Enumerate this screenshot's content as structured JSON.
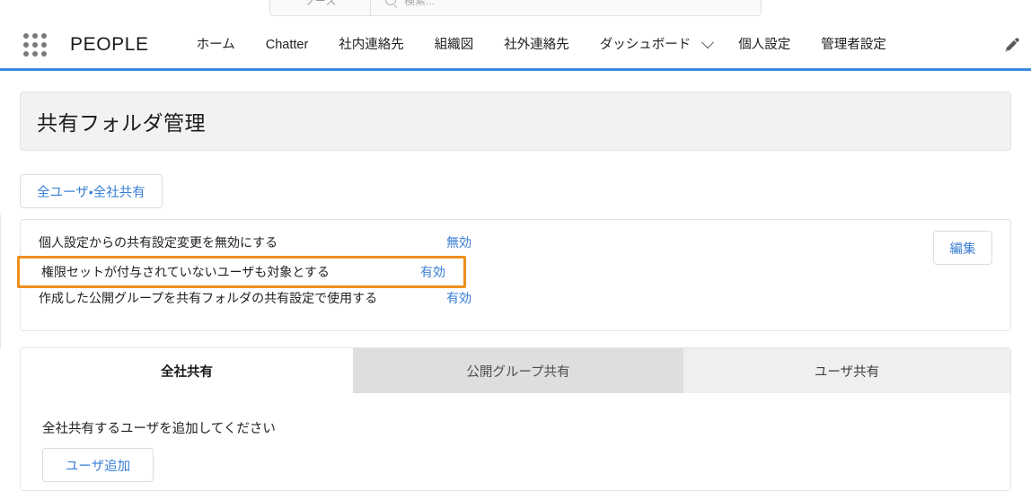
{
  "browser_strip": {
    "left_fragment": "ソース",
    "search_placeholder": "検索...",
    "search_icon": "search-icon"
  },
  "navbar": {
    "app_launcher_icon": "app-launcher-grid-icon",
    "brand": "PEOPLE",
    "items": [
      {
        "label": "ホーム",
        "has_caret": false
      },
      {
        "label": "Chatter",
        "has_caret": false
      },
      {
        "label": "社内連絡先",
        "has_caret": false
      },
      {
        "label": "組織図",
        "has_caret": false
      },
      {
        "label": "社外連絡先",
        "has_caret": false
      },
      {
        "label": "ダッシュボード",
        "has_caret": true
      },
      {
        "label": "個人設定",
        "has_caret": false
      },
      {
        "label": "管理者設定",
        "has_caret": false
      }
    ],
    "edit_icon": "pencil-icon",
    "accent_color": "#3c8ae0"
  },
  "page": {
    "title": "共有フォルダ管理",
    "scope_button": "全ユーザ・全社共有"
  },
  "settings": {
    "rows": [
      {
        "label": "個人設定からの共有設定変更を無効にする",
        "value": "無効",
        "highlighted": false
      },
      {
        "label": "権限セットが付与されていないユーザも対象とする",
        "value": "有効",
        "highlighted": true
      },
      {
        "label": "作成した公開グループを共有フォルダの共有設定で使用する",
        "value": "有効",
        "highlighted": false
      }
    ],
    "edit_button": "編集",
    "highlight_color": "#ef8f20",
    "value_color": "#3b7fd4"
  },
  "tabs": [
    {
      "label": "全社共有",
      "state": "active"
    },
    {
      "label": "公開グループ共有",
      "state": "hover"
    },
    {
      "label": "ユーザ共有",
      "state": "inactive"
    }
  ],
  "panel": {
    "prompt": "全社共有するユーザを追加してください",
    "add_user_button": "ユーザ追加"
  }
}
